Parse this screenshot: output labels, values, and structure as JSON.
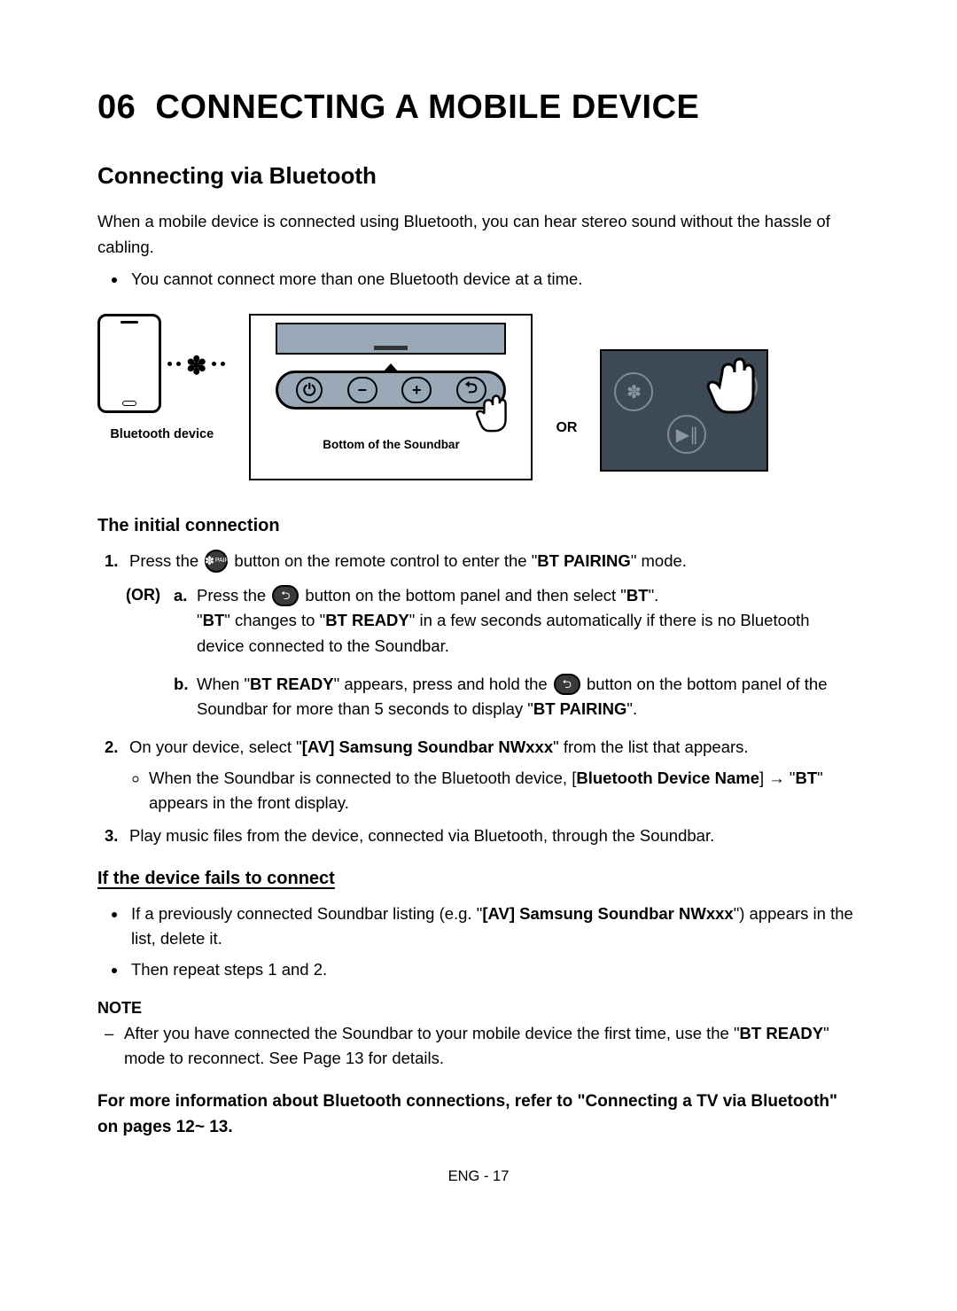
{
  "chapter": {
    "number": "06",
    "title": "CONNECTING A MOBILE DEVICE"
  },
  "section1": {
    "title": "Connecting via Bluetooth",
    "intro": "When a mobile device is connected using Bluetooth, you can hear stereo sound without the hassle of cabling.",
    "bullet1": "You cannot connect more than one Bluetooth device at a time."
  },
  "diagram": {
    "bt_device_label": "Bluetooth device",
    "soundbar_bottom_label": "Bottom of the Soundbar",
    "or_label": "OR"
  },
  "initial": {
    "heading": "The initial connection",
    "step1_pre": "Press the ",
    "step1_post": " button on the remote control to enter the \"",
    "step1_bold": "BT PAIRING",
    "step1_end": "\" mode.",
    "or_side": "(OR)",
    "a_pre": "Press the ",
    "a_mid": " button on the bottom panel and then select \"",
    "a_bt": "BT",
    "a_end": "\".",
    "a_line2_pre": "\"",
    "a_line2_bt": "BT",
    "a_line2_mid": "\" changes to \"",
    "a_line2_btready": "BT READY",
    "a_line2_post": "\" in a few seconds automatically if there is no Bluetooth device connected to the Soundbar.",
    "b_pre": "When \"",
    "b_btready": "BT READY",
    "b_mid": "\" appears, press and hold the ",
    "b_post": " button on the bottom panel of the Soundbar for more than 5 seconds to display \"",
    "b_btpairing": "BT PAIRING",
    "b_end": "\".",
    "step2_pre": "On your device, select \"",
    "step2_bold": "[AV] Samsung Soundbar NWxxx",
    "step2_post": "\" from the list that appears.",
    "step2_sub_pre": "When the Soundbar is connected to the Bluetooth device, [",
    "step2_sub_bold": "Bluetooth Device Name",
    "step2_sub_mid": "] → \"",
    "step2_sub_bt": "BT",
    "step2_sub_post": "\" appears in the front display.",
    "step3": "Play music files from the device, connected via Bluetooth, through the Soundbar."
  },
  "fails": {
    "heading": "If the device fails to connect",
    "b1_pre": "If a previously connected Soundbar listing (e.g. \"",
    "b1_bold": "[AV] Samsung Soundbar NWxxx",
    "b1_post": "\") appears in the list, delete it.",
    "b2": "Then repeat steps 1 and 2."
  },
  "note": {
    "label": "NOTE",
    "n1_pre": "After you have connected the Soundbar to your mobile device the first time, use the \"",
    "n1_bold": "BT READY",
    "n1_post": "\" mode to reconnect. See Page 13 for details."
  },
  "xref": "For more information about Bluetooth connections, refer to \"Connecting a TV via Bluetooth\" on pages 12~ 13.",
  "footer": "ENG - 17"
}
